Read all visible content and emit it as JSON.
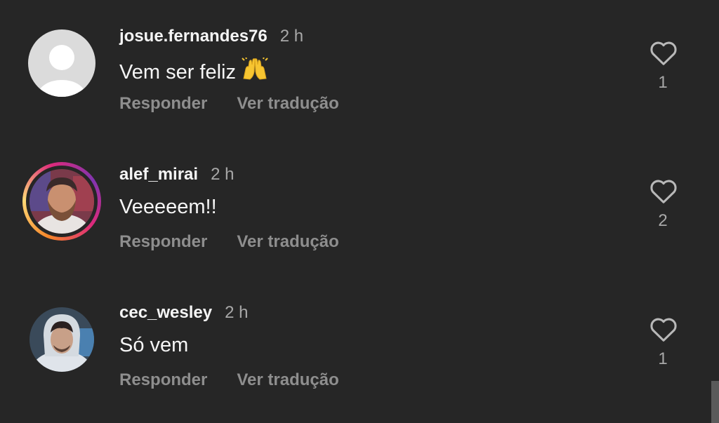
{
  "comments": [
    {
      "username": "josue.fernandes76",
      "time": "2 h",
      "text": "Vem ser feliz",
      "emoji": "raising-hands",
      "reply_label": "Responder",
      "translate_label": "Ver tradução",
      "likes": "1",
      "avatar": "default-avatar",
      "story_ring": false
    },
    {
      "username": "alef_mirai",
      "time": "2 h",
      "text": "Veeeeem!!",
      "reply_label": "Responder",
      "translate_label": "Ver tradução",
      "likes": "2",
      "avatar": "profile-photo",
      "story_ring": true
    },
    {
      "username": "cec_wesley",
      "time": "2 h",
      "text": "Só vem",
      "reply_label": "Responder",
      "translate_label": "Ver tradução",
      "likes": "1",
      "avatar": "profile-photo",
      "story_ring": false
    }
  ],
  "colors": {
    "background": "#262626",
    "primary_text": "#f5f5f5",
    "secondary_text": "#a8a8a8",
    "action_text": "#8e8e8e",
    "story_ring_start": "#f58529",
    "story_ring_end": "#dd2a7b"
  }
}
